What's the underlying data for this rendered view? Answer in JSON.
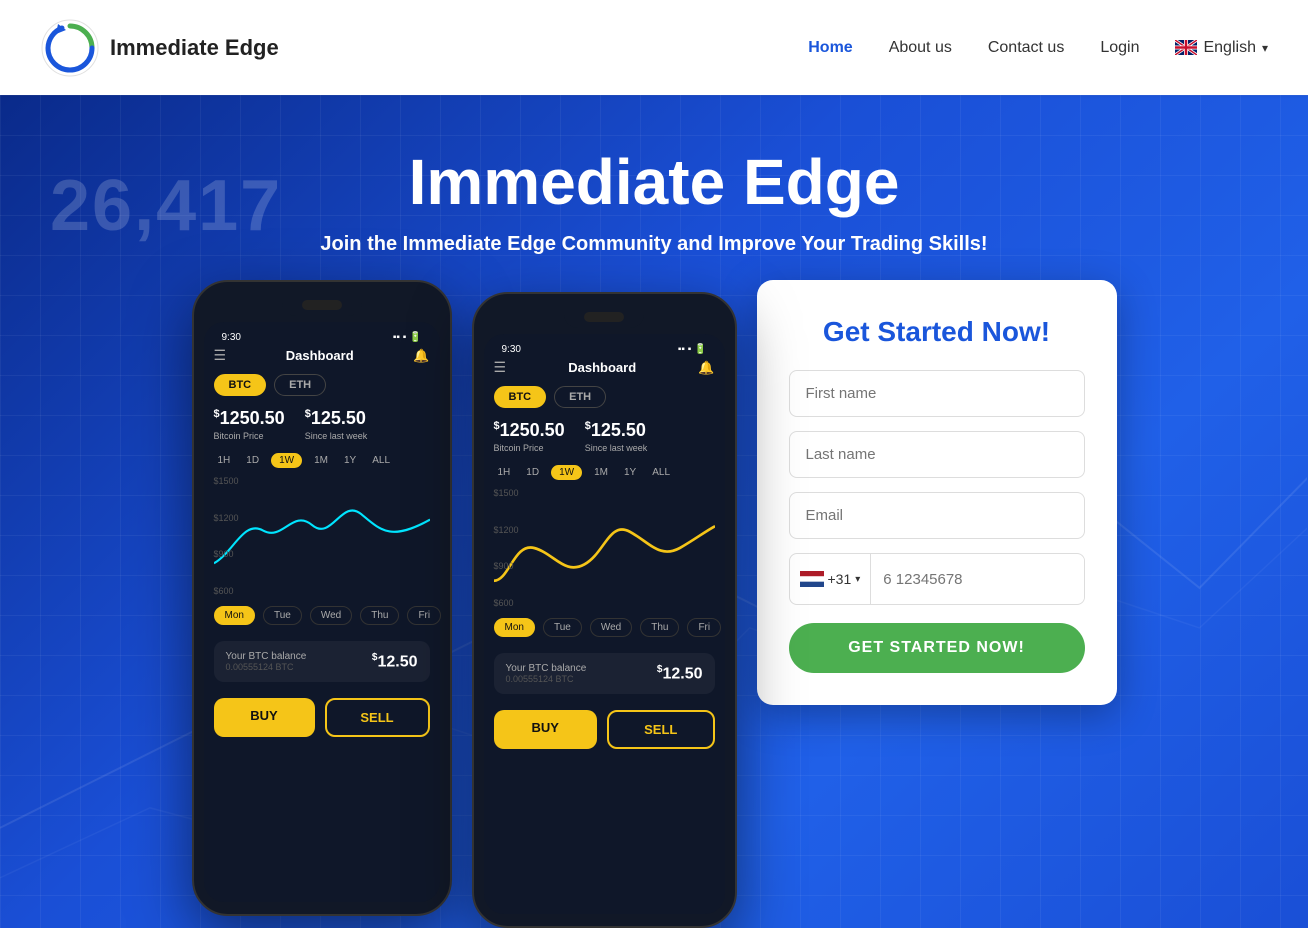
{
  "header": {
    "logo_text": "Immediate Edge",
    "nav": {
      "home": "Home",
      "about": "About us",
      "contact": "Contact us",
      "login": "Login",
      "language": "English"
    }
  },
  "hero": {
    "bg_number": "26,417",
    "title": "Immediate Edge",
    "subtitle": "Join the Immediate Edge Community and Improve Your Trading Skills!"
  },
  "phone1": {
    "time": "9:30",
    "title": "Dashboard",
    "tabs": [
      "BTC",
      "ETH"
    ],
    "price1": "$1250.50",
    "price1_label": "Bitcoin Price",
    "price2": "$125.50",
    "price2_label": "Since last week",
    "timeframes": [
      "1H",
      "1D",
      "1W",
      "1M",
      "1Y",
      "ALL"
    ],
    "active_tf": "1W",
    "chart_labels": [
      "$1500",
      "$1200",
      "$900",
      "$600"
    ],
    "days": [
      "Mon",
      "Tue",
      "Wed",
      "Thu",
      "Fri"
    ],
    "active_day": "Mon",
    "balance_label": "Your BTC balance",
    "balance_sub": "0.00555124 BTC",
    "balance_amount": "$12.50",
    "buy": "BUY",
    "sell": "SELL"
  },
  "phone2": {
    "time": "9:30",
    "title": "Dashboard",
    "tabs": [
      "BTC",
      "ETH"
    ],
    "price1": "$1250.50",
    "price1_label": "Bitcoin Price",
    "price2": "$125.50",
    "price2_label": "Since last week",
    "timeframes": [
      "1H",
      "1D",
      "1W",
      "1M",
      "1Y",
      "ALL"
    ],
    "active_tf": "1W",
    "chart_labels": [
      "$1500",
      "$1200",
      "$900",
      "$600"
    ],
    "days": [
      "Mon",
      "Tue",
      "Wed",
      "Thu",
      "Fri"
    ],
    "active_day": "Mon",
    "balance_label": "Your BTC balance",
    "balance_sub": "0.00555124 BTC",
    "balance_amount": "$12.50",
    "buy": "BUY",
    "sell": "SELL"
  },
  "form": {
    "title": "Get Started Now!",
    "first_name_placeholder": "First name",
    "last_name_placeholder": "Last name",
    "email_placeholder": "Email",
    "phone_flag": "🇳🇱",
    "phone_code": "+31",
    "phone_placeholder": "6 12345678",
    "cta_label": "GET STARTED NOW!"
  }
}
